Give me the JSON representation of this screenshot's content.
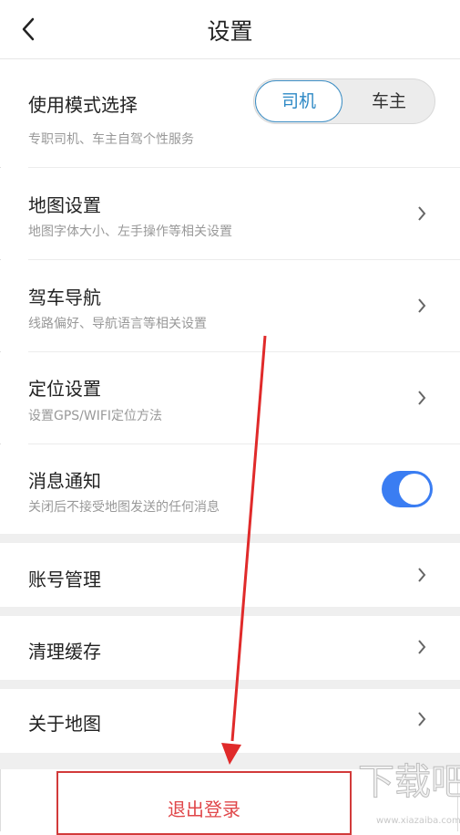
{
  "header": {
    "title": "设置"
  },
  "mode": {
    "title": "使用模式选择",
    "subtitle": "专职司机、车主自驾个性服务",
    "options": [
      "司机",
      "车主"
    ],
    "selected": "司机"
  },
  "settings": [
    {
      "title": "地图设置",
      "subtitle": "地图字体大小、左手操作等相关设置"
    },
    {
      "title": "驾车导航",
      "subtitle": "线路偏好、导航语言等相关设置"
    },
    {
      "title": "定位设置",
      "subtitle": "设置GPS/WIFI定位方法"
    }
  ],
  "notify": {
    "title": "消息通知",
    "subtitle": "关闭后不接受地图发送的任何消息",
    "enabled": true
  },
  "account": {
    "title": "账号管理"
  },
  "cache": {
    "title": "清理缓存"
  },
  "about": {
    "title": "关于地图"
  },
  "logout": {
    "label": "退出登录"
  },
  "watermark": {
    "text": "下载吧",
    "url": "www.xiazaiba.com"
  },
  "colors": {
    "accent": "#2c88c5",
    "toggle": "#3a7df2",
    "annotation": "#e02a2a",
    "logout": "#e0474a"
  }
}
